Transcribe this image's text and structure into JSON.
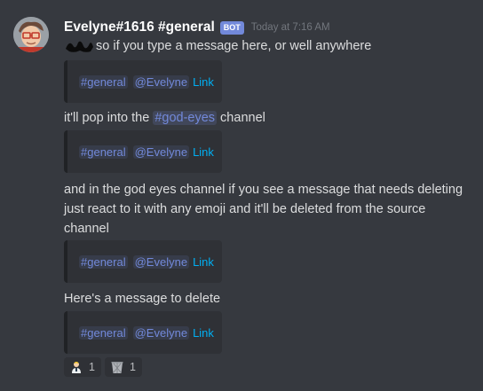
{
  "message": {
    "username": "Evelyne#1616 #general",
    "bot_tag": "BOT",
    "timestamp": "Today at 7:16 AM",
    "lines": {
      "first": "so if you type a message here, or well anywhere",
      "second_pre": "it'll pop into the ",
      "second_mention": "#god-eyes",
      "second_post": " channel",
      "third_1": "and in the god eyes channel if you see a message that needs deleting",
      "third_2": "just react to it with any emoji and it'll be deleted from the source",
      "third_3": "channel",
      "fourth": "Here's a message to delete"
    },
    "embed": {
      "channel": "#general",
      "user": "@Evelyne",
      "link": "Link"
    },
    "reactions": [
      {
        "emoji": "person-emoji",
        "count": "1"
      },
      {
        "emoji": "wastebasket-emoji",
        "count": "1"
      }
    ]
  },
  "colors": {
    "background": "#36393f",
    "embed_background": "#2f3136",
    "mention": "#7289da",
    "link": "#00b0f4",
    "username": "#ffffff",
    "timestamp": "#72767d"
  }
}
